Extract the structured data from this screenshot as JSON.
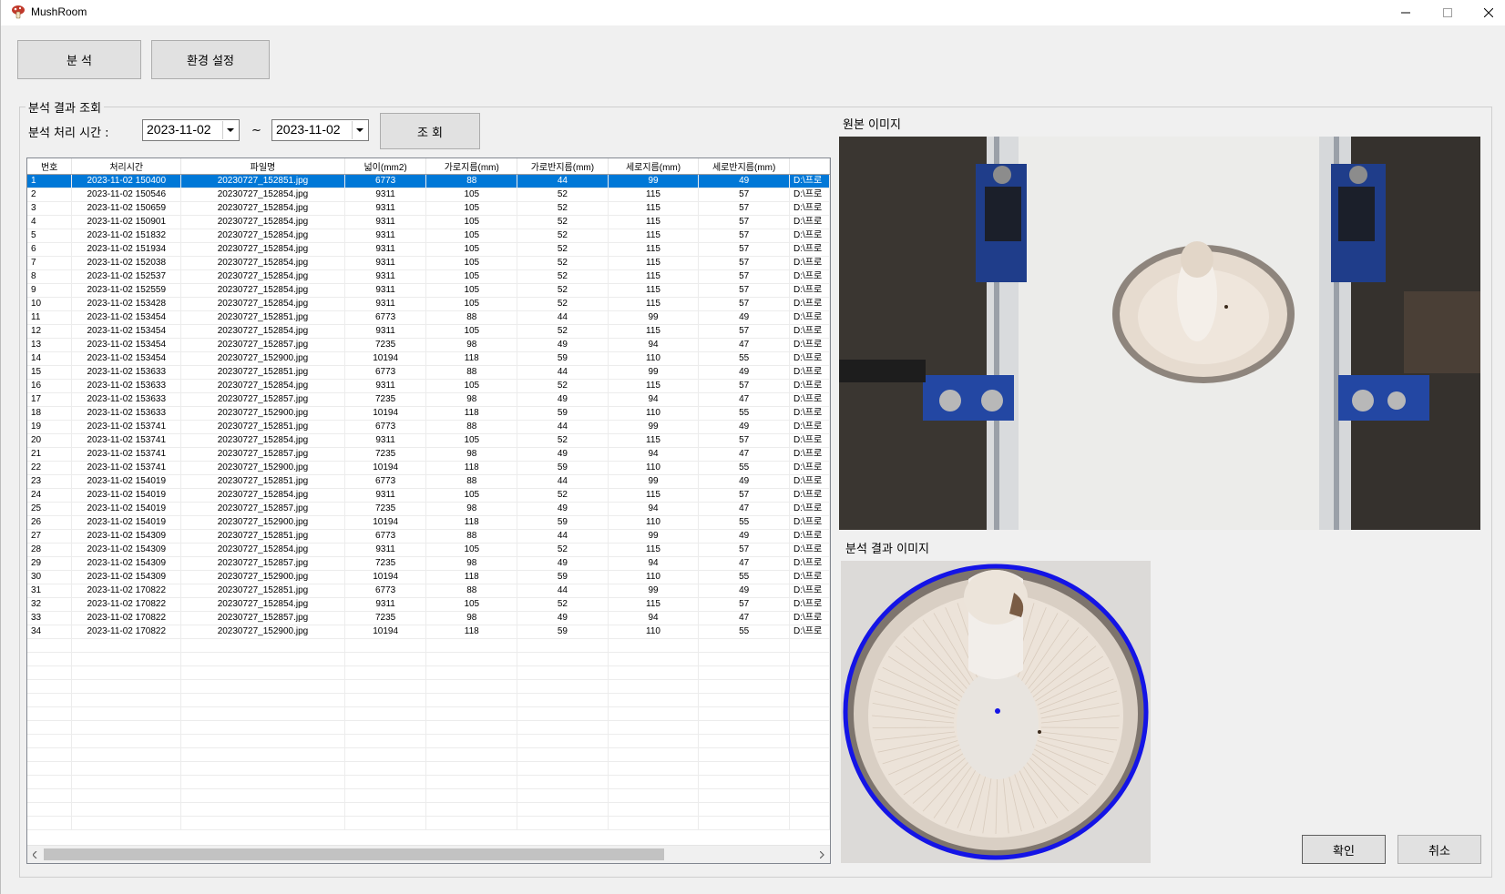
{
  "window": {
    "title": "MushRoom"
  },
  "toolbar": {
    "analysis_label": "분 석",
    "settings_label": "환경 설정"
  },
  "query": {
    "group_title": "분석 결과 조회",
    "time_label": "분석 처리 시간 :",
    "date_from": "2023-11-02",
    "date_to": "2023-11-02",
    "tilde": "~",
    "query_label": "조 회"
  },
  "table": {
    "columns": [
      "번호",
      "처리시간",
      "파일명",
      "넓이(mm2)",
      "가로지름(mm)",
      "가로반지름(mm)",
      "세로지름(mm)",
      "세로반지름(mm)",
      ""
    ],
    "selected_row": 0,
    "rows": [
      [
        "1",
        "2023-11-02 150400",
        "20230727_152851.jpg",
        "6773",
        "88",
        "44",
        "99",
        "49",
        "D:\\프로"
      ],
      [
        "2",
        "2023-11-02 150546",
        "20230727_152854.jpg",
        "9311",
        "105",
        "52",
        "115",
        "57",
        "D:\\프로"
      ],
      [
        "3",
        "2023-11-02 150659",
        "20230727_152854.jpg",
        "9311",
        "105",
        "52",
        "115",
        "57",
        "D:\\프로"
      ],
      [
        "4",
        "2023-11-02 150901",
        "20230727_152854.jpg",
        "9311",
        "105",
        "52",
        "115",
        "57",
        "D:\\프로"
      ],
      [
        "5",
        "2023-11-02 151832",
        "20230727_152854.jpg",
        "9311",
        "105",
        "52",
        "115",
        "57",
        "D:\\프로"
      ],
      [
        "6",
        "2023-11-02 151934",
        "20230727_152854.jpg",
        "9311",
        "105",
        "52",
        "115",
        "57",
        "D:\\프로"
      ],
      [
        "7",
        "2023-11-02 152038",
        "20230727_152854.jpg",
        "9311",
        "105",
        "52",
        "115",
        "57",
        "D:\\프로"
      ],
      [
        "8",
        "2023-11-02 152537",
        "20230727_152854.jpg",
        "9311",
        "105",
        "52",
        "115",
        "57",
        "D:\\프로"
      ],
      [
        "9",
        "2023-11-02 152559",
        "20230727_152854.jpg",
        "9311",
        "105",
        "52",
        "115",
        "57",
        "D:\\프로"
      ],
      [
        "10",
        "2023-11-02 153428",
        "20230727_152854.jpg",
        "9311",
        "105",
        "52",
        "115",
        "57",
        "D:\\프로"
      ],
      [
        "11",
        "2023-11-02 153454",
        "20230727_152851.jpg",
        "6773",
        "88",
        "44",
        "99",
        "49",
        "D:\\프로"
      ],
      [
        "12",
        "2023-11-02 153454",
        "20230727_152854.jpg",
        "9311",
        "105",
        "52",
        "115",
        "57",
        "D:\\프로"
      ],
      [
        "13",
        "2023-11-02 153454",
        "20230727_152857.jpg",
        "7235",
        "98",
        "49",
        "94",
        "47",
        "D:\\프로"
      ],
      [
        "14",
        "2023-11-02 153454",
        "20230727_152900.jpg",
        "10194",
        "118",
        "59",
        "110",
        "55",
        "D:\\프로"
      ],
      [
        "15",
        "2023-11-02 153633",
        "20230727_152851.jpg",
        "6773",
        "88",
        "44",
        "99",
        "49",
        "D:\\프로"
      ],
      [
        "16",
        "2023-11-02 153633",
        "20230727_152854.jpg",
        "9311",
        "105",
        "52",
        "115",
        "57",
        "D:\\프로"
      ],
      [
        "17",
        "2023-11-02 153633",
        "20230727_152857.jpg",
        "7235",
        "98",
        "49",
        "94",
        "47",
        "D:\\프로"
      ],
      [
        "18",
        "2023-11-02 153633",
        "20230727_152900.jpg",
        "10194",
        "118",
        "59",
        "110",
        "55",
        "D:\\프로"
      ],
      [
        "19",
        "2023-11-02 153741",
        "20230727_152851.jpg",
        "6773",
        "88",
        "44",
        "99",
        "49",
        "D:\\프로"
      ],
      [
        "20",
        "2023-11-02 153741",
        "20230727_152854.jpg",
        "9311",
        "105",
        "52",
        "115",
        "57",
        "D:\\프로"
      ],
      [
        "21",
        "2023-11-02 153741",
        "20230727_152857.jpg",
        "7235",
        "98",
        "49",
        "94",
        "47",
        "D:\\프로"
      ],
      [
        "22",
        "2023-11-02 153741",
        "20230727_152900.jpg",
        "10194",
        "118",
        "59",
        "110",
        "55",
        "D:\\프로"
      ],
      [
        "23",
        "2023-11-02 154019",
        "20230727_152851.jpg",
        "6773",
        "88",
        "44",
        "99",
        "49",
        "D:\\프로"
      ],
      [
        "24",
        "2023-11-02 154019",
        "20230727_152854.jpg",
        "9311",
        "105",
        "52",
        "115",
        "57",
        "D:\\프로"
      ],
      [
        "25",
        "2023-11-02 154019",
        "20230727_152857.jpg",
        "7235",
        "98",
        "49",
        "94",
        "47",
        "D:\\프로"
      ],
      [
        "26",
        "2023-11-02 154019",
        "20230727_152900.jpg",
        "10194",
        "118",
        "59",
        "110",
        "55",
        "D:\\프로"
      ],
      [
        "27",
        "2023-11-02 154309",
        "20230727_152851.jpg",
        "6773",
        "88",
        "44",
        "99",
        "49",
        "D:\\프로"
      ],
      [
        "28",
        "2023-11-02 154309",
        "20230727_152854.jpg",
        "9311",
        "105",
        "52",
        "115",
        "57",
        "D:\\프로"
      ],
      [
        "29",
        "2023-11-02 154309",
        "20230727_152857.jpg",
        "7235",
        "98",
        "49",
        "94",
        "47",
        "D:\\프로"
      ],
      [
        "30",
        "2023-11-02 154309",
        "20230727_152900.jpg",
        "10194",
        "118",
        "59",
        "110",
        "55",
        "D:\\프로"
      ],
      [
        "31",
        "2023-11-02 170822",
        "20230727_152851.jpg",
        "6773",
        "88",
        "44",
        "99",
        "49",
        "D:\\프로"
      ],
      [
        "32",
        "2023-11-02 170822",
        "20230727_152854.jpg",
        "9311",
        "105",
        "52",
        "115",
        "57",
        "D:\\프로"
      ],
      [
        "33",
        "2023-11-02 170822",
        "20230727_152857.jpg",
        "7235",
        "98",
        "49",
        "94",
        "47",
        "D:\\프로"
      ],
      [
        "34",
        "2023-11-02 170822",
        "20230727_152900.jpg",
        "10194",
        "118",
        "59",
        "110",
        "55",
        "D:\\프로"
      ]
    ]
  },
  "images": {
    "original_label": "원본 이미지",
    "result_label": "분석 결과 이미지"
  },
  "footer": {
    "ok_label": "확인",
    "cancel_label": "취소"
  },
  "colors": {
    "selection": "#0078d7",
    "detect_circle": "#1414e6"
  }
}
